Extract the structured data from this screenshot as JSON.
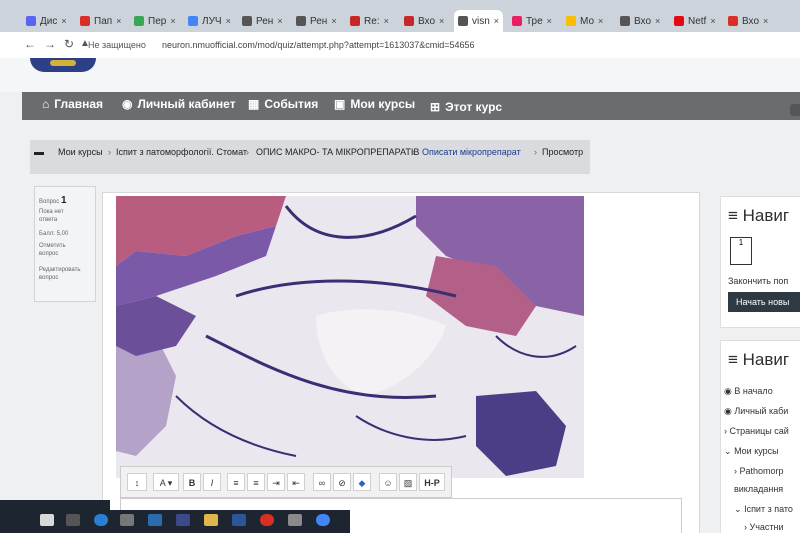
{
  "tabs": [
    {
      "label": "Дис",
      "icon": "discord-icon",
      "color": "#5865f2"
    },
    {
      "label": "Пап",
      "icon": "gmail-icon",
      "color": "#d93025"
    },
    {
      "label": "Пер",
      "icon": "flower-icon",
      "color": "#3aa757"
    },
    {
      "label": "ЛУЧ",
      "icon": "google-icon",
      "color": "#4285f4"
    },
    {
      "label": "Рен",
      "icon": "document-icon",
      "color": "#555555"
    },
    {
      "label": "Рен",
      "icon": "document-icon",
      "color": "#555555"
    },
    {
      "label": "Re:",
      "icon": "bracket-icon",
      "color": "#c62828"
    },
    {
      "label": "Вхо",
      "icon": "bracket-icon",
      "color": "#c62828"
    },
    {
      "label": "visn",
      "icon": "globe-icon",
      "color": "#555555"
    },
    {
      "label": "Тре",
      "icon": "pinwheel-icon",
      "color": "#e91e63"
    },
    {
      "label": "Мо",
      "icon": "drive-icon",
      "color": "#fbbc04"
    },
    {
      "label": "Вхо",
      "icon": "globe-icon",
      "color": "#555555"
    },
    {
      "label": "Netf",
      "icon": "netflix-icon",
      "color": "#e50914"
    },
    {
      "label": "Вхо",
      "icon": "gmail-icon",
      "color": "#d93025"
    }
  ],
  "address": {
    "security": "Не защищено",
    "url": "neuron.nmuofficial.com/mod/quiz/attempt.php?attempt=1613037&cmid=54656"
  },
  "mainnav": {
    "home": "Главная",
    "cabinet": "Личный кабинет",
    "events": "События",
    "mycourses": "Мои курсы",
    "thiscourse": "Этот курс"
  },
  "breadcrumb": {
    "c1": "Мои курсы",
    "c2": "Іспит з патоморфології. Стомат",
    "c3": "ОПИС МАКРО- ТА МІКРОПРЕПАРАТІВ",
    "c4": "Описати мікропрепарат",
    "c5": "Просмотр"
  },
  "question": {
    "label": "Вопрос",
    "number": "1",
    "status1": "Пока нет",
    "status2": "ответа",
    "points": "Балл: 5,00",
    "flag1": "Отметить",
    "flag2": "вопрос",
    "edit1": "Редактировать",
    "edit2": "вопрос"
  },
  "toolbar": {
    "font": "A",
    "bold": "B",
    "italic": "I",
    "hp": "H-P"
  },
  "sidebar": {
    "nav_title": "Навиг",
    "box_number": "1",
    "finish": "Закончить поп",
    "start": "Начать новы",
    "nav2_title": "Навиг",
    "items": [
      "В начало",
      "Личный каби",
      "Страницы сай",
      "Мои курсы",
      "Pathomorp",
      "викладання",
      "Іспит з пато",
      "Участни"
    ]
  }
}
